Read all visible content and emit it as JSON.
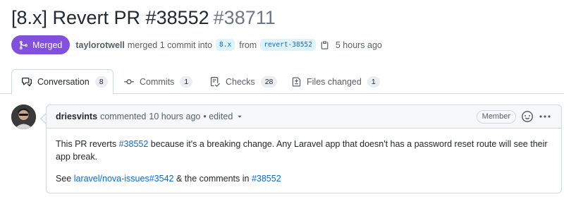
{
  "pr": {
    "title": "[8.x] Revert PR #38552",
    "number": "#38711",
    "status_label": "Merged",
    "author": "taylorotwell",
    "merged_text": "merged 1 commit into",
    "base_branch": "8.x",
    "from_text": "from",
    "head_branch": "revert-38552",
    "time_ago": "5 hours ago",
    "status_color": "#8250df"
  },
  "tabs": [
    {
      "label": "Conversation",
      "count": "8",
      "icon": "comment-discussion-icon"
    },
    {
      "label": "Commits",
      "count": "1",
      "icon": "git-commit-icon"
    },
    {
      "label": "Checks",
      "count": "28",
      "icon": "checklist-icon"
    },
    {
      "label": "Files changed",
      "count": "1",
      "icon": "file-diff-icon"
    }
  ],
  "comment": {
    "author": "driesvints",
    "action": "commented",
    "time": "10 hours ago",
    "edited": "• edited",
    "role_badge": "Member",
    "body": {
      "p1_start": "This PR reverts ",
      "p1_link": "#38552",
      "p1_end": " because it's a breaking change. Any Laravel app that doesn't has a password reset route will see their app break.",
      "p2_start": "See ",
      "p2_link1": "laravel/nova-issues#3542",
      "p2_mid": " & the comments in ",
      "p2_link2": "#38552"
    }
  },
  "colors": {
    "link": "#0969da",
    "border": "#d0d7de",
    "muted": "#57606a"
  }
}
